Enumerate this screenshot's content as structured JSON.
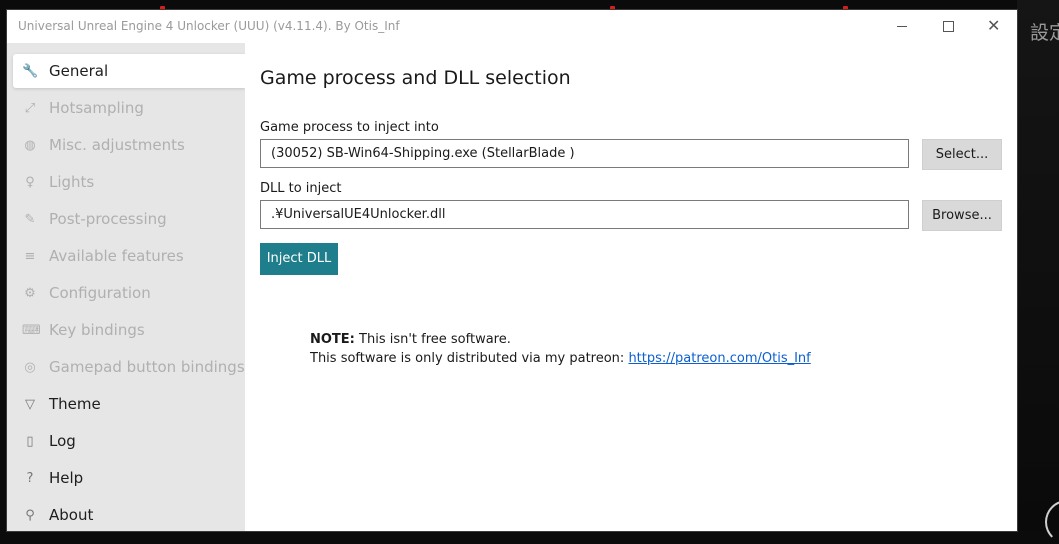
{
  "background": {
    "right_text": "設定"
  },
  "window": {
    "title": "Universal Unreal Engine 4 Unlocker (UUU) (v4.11.4). By Otis_Inf",
    "controls": {
      "minimize": "—",
      "maximize": "□",
      "close": "✕"
    }
  },
  "sidebar": {
    "items": [
      {
        "label": "General",
        "icon": "wrench-icon",
        "glyph": "🔧",
        "state": "selected"
      },
      {
        "label": "Hotsampling",
        "icon": "resize-icon",
        "glyph": "⤢",
        "state": "disabled"
      },
      {
        "label": "Misc. adjustments",
        "icon": "globe-icon",
        "glyph": "◍",
        "state": "disabled"
      },
      {
        "label": "Lights",
        "icon": "lightbulb-icon",
        "glyph": "♀",
        "state": "disabled"
      },
      {
        "label": "Post-processing",
        "icon": "brush-icon",
        "glyph": "✎",
        "state": "disabled"
      },
      {
        "label": "Available features",
        "icon": "list-icon",
        "glyph": "≡",
        "state": "disabled"
      },
      {
        "label": "Configuration",
        "icon": "gear-icon",
        "glyph": "⚙",
        "state": "disabled"
      },
      {
        "label": "Key bindings",
        "icon": "keyboard-icon",
        "glyph": "⌨",
        "state": "disabled"
      },
      {
        "label": "Gamepad button bindings",
        "icon": "gamepad-icon",
        "glyph": "◎",
        "state": "disabled"
      },
      {
        "label": "Theme",
        "icon": "bucket-icon",
        "glyph": "▽",
        "state": "normal"
      },
      {
        "label": "Log",
        "icon": "document-icon",
        "glyph": "▯",
        "state": "normal"
      },
      {
        "label": "Help",
        "icon": "question-icon",
        "glyph": "?",
        "state": "normal"
      },
      {
        "label": "About",
        "icon": "people-icon",
        "glyph": "⚲",
        "state": "normal"
      }
    ]
  },
  "main": {
    "heading": "Game process and DLL selection",
    "process": {
      "label": "Game process to inject into",
      "value": "(30052) SB-Win64-Shipping.exe (StellarBlade  )",
      "button": "Select..."
    },
    "dll": {
      "label": "DLL to inject",
      "value": ".¥UniversalUE4Unlocker.dll",
      "button": "Browse..."
    },
    "inject_button": "Inject DLL",
    "note": {
      "prefix": "NOTE:",
      "line1": " This isn't free software.",
      "line2": "This software is only distributed via my patreon: ",
      "link": "https://patreon.com/Otis_Inf"
    }
  },
  "colors": {
    "accent": "#1f7e8c",
    "sidebar_bg": "#e6e6e6",
    "link": "#0b5fd1",
    "disabled_text": "#b0b0b0"
  }
}
